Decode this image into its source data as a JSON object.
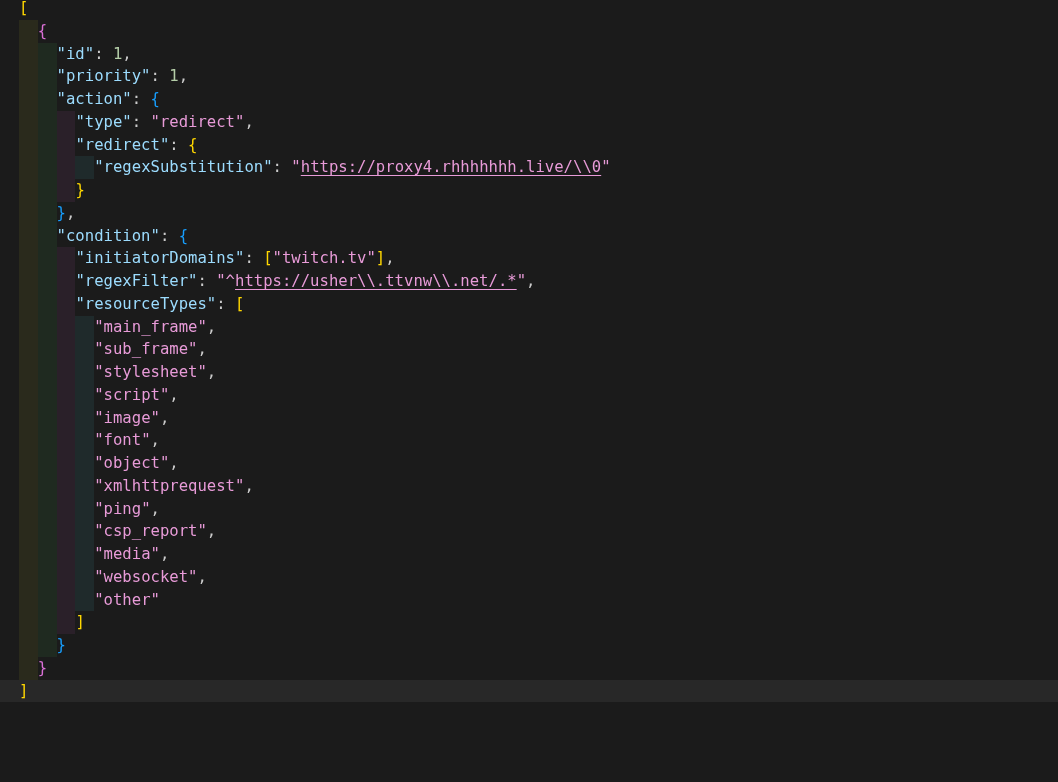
{
  "editor": {
    "lines": [
      {
        "current": false,
        "tokens": [
          {
            "kind": "bracket",
            "text": "[",
            "color": "#ffd700"
          }
        ],
        "children": [
          {
            "current": false,
            "tokens": [
              {
                "kind": "bracket",
                "text": "{",
                "color": "#da70d6"
              }
            ],
            "children": [
              {
                "current": false,
                "tokens": [
                  {
                    "kind": "key",
                    "text": "\"id\""
                  },
                  {
                    "kind": "punct",
                    "text": ": "
                  },
                  {
                    "kind": "number",
                    "text": "1"
                  },
                  {
                    "kind": "punct",
                    "text": ","
                  }
                ]
              },
              {
                "current": false,
                "tokens": [
                  {
                    "kind": "key",
                    "text": "\"priority\""
                  },
                  {
                    "kind": "punct",
                    "text": ": "
                  },
                  {
                    "kind": "number",
                    "text": "1"
                  },
                  {
                    "kind": "punct",
                    "text": ","
                  }
                ]
              },
              {
                "current": false,
                "tokens": [
                  {
                    "kind": "key",
                    "text": "\"action\""
                  },
                  {
                    "kind": "punct",
                    "text": ": "
                  },
                  {
                    "kind": "bracket",
                    "text": "{",
                    "color": "#179fff"
                  }
                ],
                "children": [
                  {
                    "current": false,
                    "tokens": [
                      {
                        "kind": "key",
                        "text": "\"type\""
                      },
                      {
                        "kind": "punct",
                        "text": ": "
                      },
                      {
                        "kind": "string",
                        "text": "\"redirect\""
                      },
                      {
                        "kind": "punct",
                        "text": ","
                      }
                    ]
                  },
                  {
                    "current": false,
                    "tokens": [
                      {
                        "kind": "key",
                        "text": "\"redirect\""
                      },
                      {
                        "kind": "punct",
                        "text": ": "
                      },
                      {
                        "kind": "bracket",
                        "text": "{",
                        "color": "#ffd700"
                      }
                    ],
                    "children": [
                      {
                        "current": false,
                        "tokens": [
                          {
                            "kind": "key",
                            "text": "\"regexSubstitution\""
                          },
                          {
                            "kind": "punct",
                            "text": ": "
                          },
                          {
                            "kind": "string",
                            "text": "\""
                          },
                          {
                            "kind": "link",
                            "text": "https://proxy4.rhhhhhhh.live/\\\\0"
                          },
                          {
                            "kind": "string",
                            "text": "\""
                          }
                        ]
                      }
                    ]
                  },
                  {
                    "current": false,
                    "tokens": [
                      {
                        "kind": "bracket",
                        "text": "}",
                        "color": "#ffd700"
                      }
                    ]
                  }
                ]
              },
              {
                "current": false,
                "tokens": [
                  {
                    "kind": "bracket",
                    "text": "}",
                    "color": "#179fff"
                  },
                  {
                    "kind": "punct",
                    "text": ","
                  }
                ]
              },
              {
                "current": false,
                "tokens": [
                  {
                    "kind": "key",
                    "text": "\"condition\""
                  },
                  {
                    "kind": "punct",
                    "text": ": "
                  },
                  {
                    "kind": "bracket",
                    "text": "{",
                    "color": "#179fff"
                  }
                ],
                "children": [
                  {
                    "current": false,
                    "tokens": [
                      {
                        "kind": "key",
                        "text": "\"initiatorDomains\""
                      },
                      {
                        "kind": "punct",
                        "text": ": "
                      },
                      {
                        "kind": "bracket",
                        "text": "[",
                        "color": "#ffd700"
                      },
                      {
                        "kind": "string",
                        "text": "\"twitch.tv\""
                      },
                      {
                        "kind": "bracket",
                        "text": "]",
                        "color": "#ffd700"
                      },
                      {
                        "kind": "punct",
                        "text": ","
                      }
                    ]
                  },
                  {
                    "current": false,
                    "tokens": [
                      {
                        "kind": "key",
                        "text": "\"regexFilter\""
                      },
                      {
                        "kind": "punct",
                        "text": ": "
                      },
                      {
                        "kind": "string",
                        "text": "\"^"
                      },
                      {
                        "kind": "link",
                        "text": "https://usher\\\\.ttvnw\\\\.net/.*"
                      },
                      {
                        "kind": "string",
                        "text": "\""
                      },
                      {
                        "kind": "punct",
                        "text": ","
                      }
                    ]
                  },
                  {
                    "current": false,
                    "tokens": [
                      {
                        "kind": "key",
                        "text": "\"resourceTypes\""
                      },
                      {
                        "kind": "punct",
                        "text": ": "
                      },
                      {
                        "kind": "bracket",
                        "text": "[",
                        "color": "#ffd700"
                      }
                    ],
                    "children": [
                      {
                        "current": false,
                        "tokens": [
                          {
                            "kind": "string",
                            "text": "\"main_frame\""
                          },
                          {
                            "kind": "punct",
                            "text": ","
                          }
                        ]
                      },
                      {
                        "current": false,
                        "tokens": [
                          {
                            "kind": "string",
                            "text": "\"sub_frame\""
                          },
                          {
                            "kind": "punct",
                            "text": ","
                          }
                        ]
                      },
                      {
                        "current": false,
                        "tokens": [
                          {
                            "kind": "string",
                            "text": "\"stylesheet\""
                          },
                          {
                            "kind": "punct",
                            "text": ","
                          }
                        ]
                      },
                      {
                        "current": false,
                        "tokens": [
                          {
                            "kind": "string",
                            "text": "\"script\""
                          },
                          {
                            "kind": "punct",
                            "text": ","
                          }
                        ]
                      },
                      {
                        "current": false,
                        "tokens": [
                          {
                            "kind": "string",
                            "text": "\"image\""
                          },
                          {
                            "kind": "punct",
                            "text": ","
                          }
                        ]
                      },
                      {
                        "current": false,
                        "tokens": [
                          {
                            "kind": "string",
                            "text": "\"font\""
                          },
                          {
                            "kind": "punct",
                            "text": ","
                          }
                        ]
                      },
                      {
                        "current": false,
                        "tokens": [
                          {
                            "kind": "string",
                            "text": "\"object\""
                          },
                          {
                            "kind": "punct",
                            "text": ","
                          }
                        ]
                      },
                      {
                        "current": false,
                        "tokens": [
                          {
                            "kind": "string",
                            "text": "\"xmlhttprequest\""
                          },
                          {
                            "kind": "punct",
                            "text": ","
                          }
                        ]
                      },
                      {
                        "current": false,
                        "tokens": [
                          {
                            "kind": "string",
                            "text": "\"ping\""
                          },
                          {
                            "kind": "punct",
                            "text": ","
                          }
                        ]
                      },
                      {
                        "current": false,
                        "tokens": [
                          {
                            "kind": "string",
                            "text": "\"csp_report\""
                          },
                          {
                            "kind": "punct",
                            "text": ","
                          }
                        ]
                      },
                      {
                        "current": false,
                        "tokens": [
                          {
                            "kind": "string",
                            "text": "\"media\""
                          },
                          {
                            "kind": "punct",
                            "text": ","
                          }
                        ]
                      },
                      {
                        "current": false,
                        "tokens": [
                          {
                            "kind": "string",
                            "text": "\"websocket\""
                          },
                          {
                            "kind": "punct",
                            "text": ","
                          }
                        ]
                      },
                      {
                        "current": false,
                        "tokens": [
                          {
                            "kind": "string",
                            "text": "\"other\""
                          }
                        ]
                      }
                    ]
                  },
                  {
                    "current": false,
                    "tokens": [
                      {
                        "kind": "bracket",
                        "text": "]",
                        "color": "#ffd700"
                      }
                    ]
                  }
                ]
              },
              {
                "current": false,
                "tokens": [
                  {
                    "kind": "bracket",
                    "text": "}",
                    "color": "#179fff"
                  }
                ]
              }
            ]
          },
          {
            "current": false,
            "tokens": [
              {
                "kind": "bracket",
                "text": "}",
                "color": "#da70d6"
              }
            ]
          }
        ]
      },
      {
        "current": true,
        "tokens": [
          {
            "kind": "bracket",
            "text": "]",
            "color": "#ffd700"
          }
        ]
      }
    ]
  }
}
